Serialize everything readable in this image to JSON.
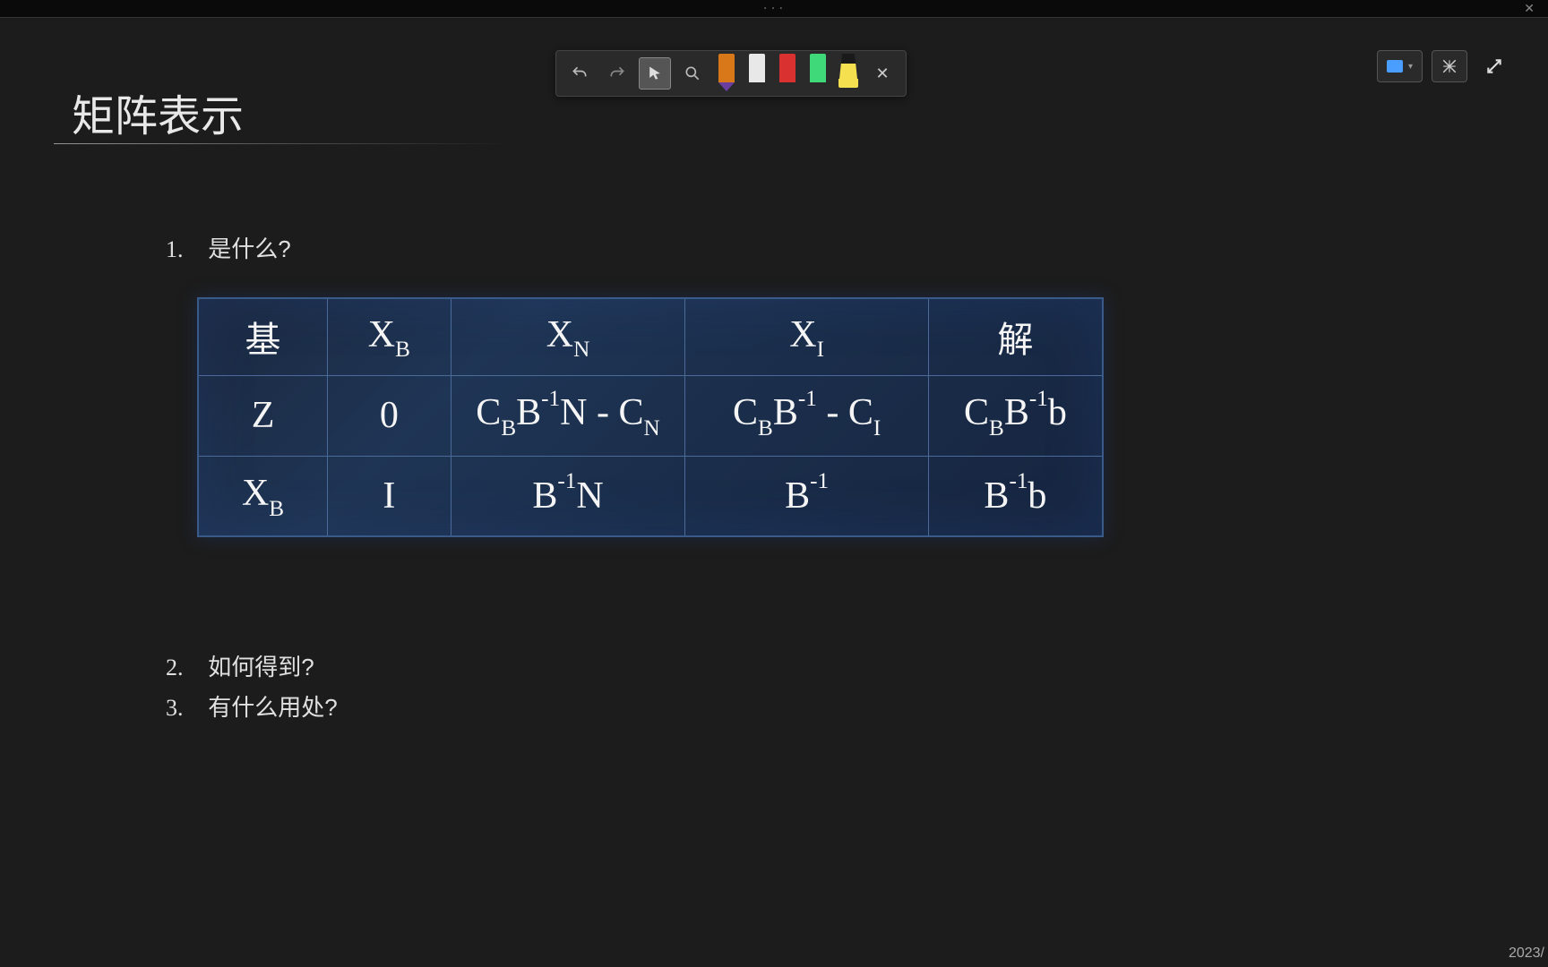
{
  "titlebar": {
    "dots": "• • •"
  },
  "toolbar": {
    "pens": [
      {
        "name": "orange-pen",
        "body_color": "#d97818",
        "tip_color": "#6a3fa0"
      },
      {
        "name": "white-pen",
        "body_color": "#e8e8e8",
        "tip_color": "#2a2a2a"
      },
      {
        "name": "red-pen",
        "body_color": "#d93030",
        "tip_color": "#2a2a2a"
      },
      {
        "name": "green-pen",
        "body_color": "#3fd97a",
        "tip_color": "#2a2a2a"
      }
    ],
    "highlighter": {
      "name": "yellow-highlighter",
      "color": "#f5e050"
    }
  },
  "slide": {
    "title": "矩阵表示",
    "bullets": [
      {
        "num": "1.",
        "text": "是什么?"
      },
      {
        "num": "2.",
        "text": "如何得到?"
      },
      {
        "num": "3.",
        "text": "有什么用处?"
      }
    ],
    "table": {
      "header": {
        "basis": "基",
        "xb": "X_B",
        "xn": "X_N",
        "xi": "X_I",
        "sol": "解"
      },
      "row_z": {
        "label": "Z",
        "c1": "0",
        "c2": "C_B B^-1 N - C_N",
        "c3": "C_B B^-1 - C_I",
        "c4": "C_B B^-1 b"
      },
      "row_xb": {
        "label": "X_B",
        "c1": "I",
        "c2": "B^-1 N",
        "c3": "B^-1",
        "c4": "B^-1 b"
      }
    }
  },
  "footer": {
    "date": "2023/"
  }
}
